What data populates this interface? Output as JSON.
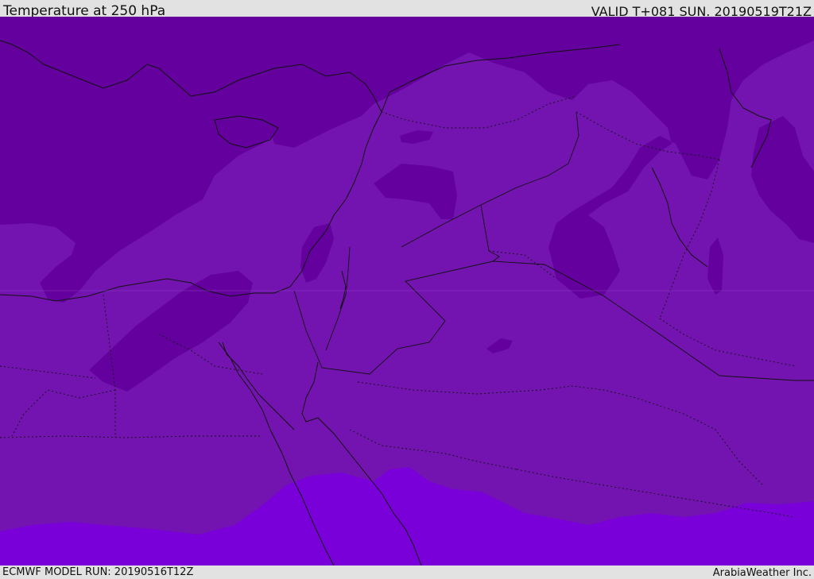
{
  "header": {
    "title": "Temperature at 250 hPa",
    "valid": "VALID T+081 SUN. 20190519T21Z"
  },
  "footer": {
    "model_run": "ECMWF MODEL RUN: 20190516T12Z",
    "credit": "ArabiaWeather Inc."
  },
  "colors": {
    "band_cold": "#64009d",
    "band_mid": "#7314b0",
    "band_warm": "#7a00d9",
    "coastline": "#111111",
    "bar_background": "#e2e2e2"
  },
  "map": {
    "field": "temperature_250hpa",
    "region": "Middle East / Eastern Mediterranean",
    "coastline_style": "solid",
    "border_style": "dotted"
  }
}
